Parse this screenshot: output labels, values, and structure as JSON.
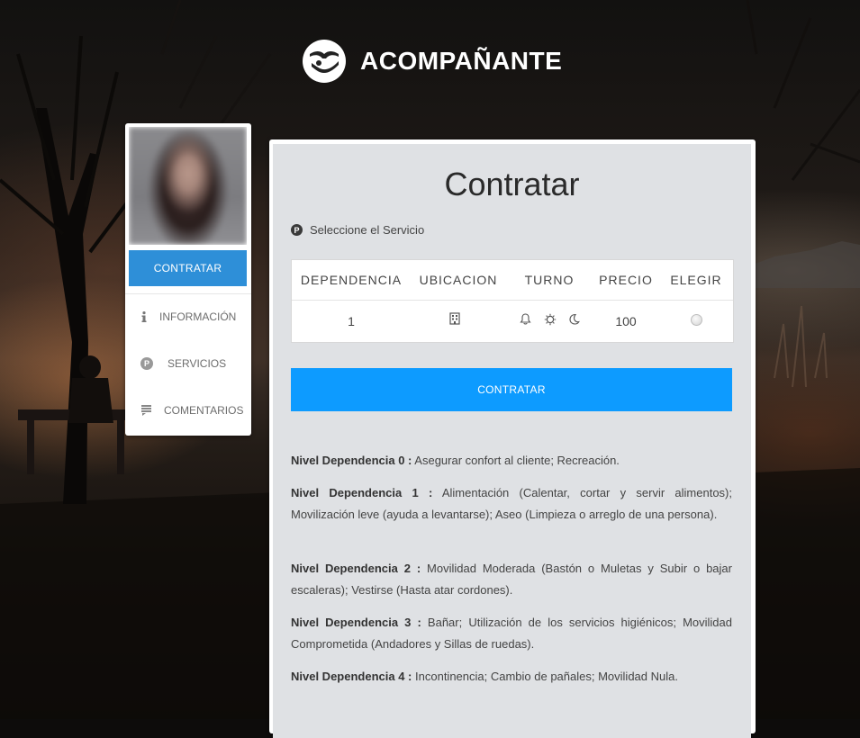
{
  "brand": {
    "name": "ACOMPAÑANTE",
    "logo_icon": "hands-icon"
  },
  "sidebar": {
    "contratar_label": "CONTRATAR",
    "items": [
      {
        "label": "INFORMACIÓN",
        "icon": "info-icon"
      },
      {
        "label": "SERVICIOS",
        "icon": "p-icon"
      },
      {
        "label": "COMENTARIOS",
        "icon": "comments-icon"
      }
    ]
  },
  "main": {
    "title": "Contratar",
    "service_label": "Seleccione el Servicio",
    "table": {
      "headers": [
        "DEPENDENCIA",
        "UBICACION",
        "TURNO",
        "PRECIO",
        "ELEGIR"
      ],
      "row": {
        "dependencia": "1",
        "ubicacion_icon": "building-icon",
        "turno_icons": [
          "bell-icon",
          "sun-icon",
          "moon-icon"
        ],
        "precio": "100",
        "elegir_selected": false
      }
    },
    "contratar_label": "CONTRATAR",
    "levels": [
      {
        "label": "Nivel Dependencia 0 :",
        "text": "Asegurar confort al cliente; Recreación."
      },
      {
        "label": "Nivel Dependencia 1 :",
        "text": "Alimentación (Calentar, cortar y servir alimentos); Movilización leve (ayuda a levantarse); Aseo (Limpieza o arreglo de una persona)."
      },
      {
        "label": "Nivel Dependencia 2 :",
        "text": "Movilidad Moderada (Bastón o Muletas y Subir o bajar escaleras); Vestirse (Hasta atar cordones)."
      },
      {
        "label": "Nivel Dependencia 3 :",
        "text": "Bañar; Utilización de los servicios higiénicos; Movilidad Comprometida (Andadores y Sillas de ruedas)."
      },
      {
        "label": "Nivel Dependencia 4 :",
        "text": "Incontinencia; Cambio de pañales; Movilidad Nula."
      }
    ]
  },
  "colors": {
    "sidebar_button": "#2e8fd8",
    "main_button": "#0d9bff",
    "panel_bg": "#dfe1e4"
  }
}
